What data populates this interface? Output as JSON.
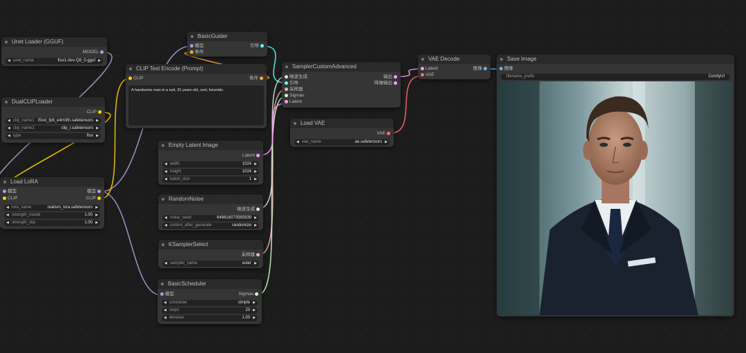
{
  "colors": {
    "model": "#b39ddb",
    "clip": "#ffd500",
    "conditioning": "#ffa931",
    "latent": "#ff9cf9",
    "vae": "#ff6e6e",
    "image": "#64b5f6",
    "noise": "#e0e0e0",
    "sampler": "#ecb4b4",
    "sigmas": "#cdffcd",
    "guider": "#66ffff"
  },
  "unet_loader": {
    "title": "Unet Loader (GGUF)",
    "out_model": "MODEL",
    "widgets": [
      {
        "label": "unet_name",
        "value": "flux1-dev-Q8_0.gguf"
      }
    ]
  },
  "dualclip": {
    "title": "DualCLIPLoader",
    "out_clip": "CLIP",
    "widgets": [
      {
        "label": "clip_name1",
        "value": "t5xxl_fp8_e4m3fn.safetensors"
      },
      {
        "label": "clip_name2",
        "value": "clip_l.safetensors"
      },
      {
        "label": "type",
        "value": "flux"
      }
    ]
  },
  "lora": {
    "title": "Load LoRA",
    "in_model": "模型",
    "in_clip": "CLIP",
    "out_model": "模型",
    "out_clip": "CLIP",
    "widgets": [
      {
        "label": "lora_name",
        "value": "realism_lora.safetensors"
      },
      {
        "label": "strength_model",
        "value": "1.00"
      },
      {
        "label": "strength_clip",
        "value": "1.00"
      }
    ]
  },
  "guider": {
    "title": "BasicGuider",
    "in_model": "模型",
    "in_cond": "条件",
    "out": "引导"
  },
  "clip_encode": {
    "title": "CLIP Text Encode (Prompt)",
    "in_clip": "CLIP",
    "out": "条件",
    "prompt": "A handsome man in a suit, 25 years old, cool, futuristic"
  },
  "sampler_adv": {
    "title": "SamplerCustomAdvanced",
    "inputs": [
      "噪波生成",
      "引导",
      "采样器",
      "Sigmas",
      "Latent"
    ],
    "outputs": [
      "输出",
      "降噪输出"
    ]
  },
  "vae_loader": {
    "title": "Load VAE",
    "out": "VAE",
    "widgets": [
      {
        "label": "vae_name",
        "value": "ae.safetensors"
      }
    ]
  },
  "empty_latent": {
    "title": "Empty Latent Image",
    "out": "Latent",
    "widgets": [
      {
        "label": "width",
        "value": "1024"
      },
      {
        "label": "height",
        "value": "1024"
      },
      {
        "label": "batch_size",
        "value": "1"
      }
    ]
  },
  "random_noise": {
    "title": "RandomNoise",
    "out": "噪波生成",
    "widgets": [
      {
        "label": "noise_seed",
        "value": "646616070585939"
      },
      {
        "label": "control_after_generate",
        "value": "randomize"
      }
    ]
  },
  "ksampler_select": {
    "title": "KSamplerSelect",
    "out": "采样器",
    "widgets": [
      {
        "label": "sampler_name",
        "value": "euler"
      }
    ]
  },
  "scheduler": {
    "title": "BasicScheduler",
    "in_model": "模型",
    "out": "Sigmas",
    "widgets": [
      {
        "label": "scheduler",
        "value": "simple"
      },
      {
        "label": "steps",
        "value": "20"
      },
      {
        "label": "denoise",
        "value": "1.00"
      }
    ]
  },
  "vae_decode": {
    "title": "VAE Decode",
    "in_latent": "Latent",
    "in_vae": "VAE",
    "out": "图像"
  },
  "save_image": {
    "title": "Save Image",
    "in_image": "图像",
    "widgets": [
      {
        "label": "filename_prefix",
        "value": "ComfyUI"
      }
    ]
  }
}
